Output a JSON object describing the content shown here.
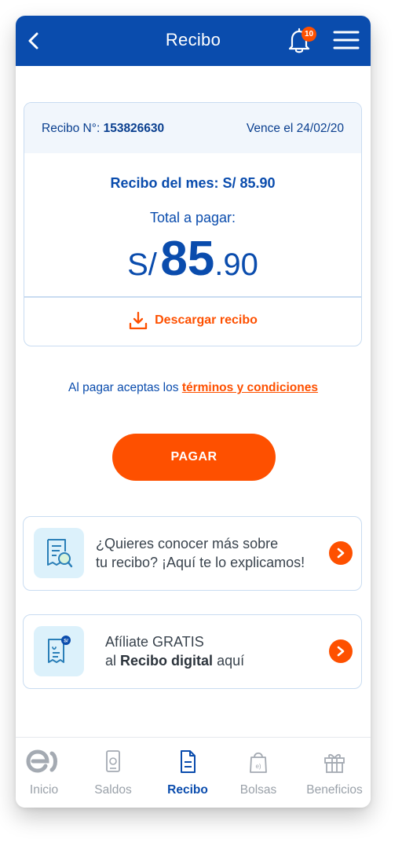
{
  "header": {
    "title": "Recibo",
    "notification_count": "10",
    "back_icon": "chevron-left-icon",
    "bell_icon": "bell-icon",
    "menu_icon": "hamburger-menu-icon"
  },
  "bill": {
    "number_label": "Recibo N°:",
    "number_value": "153826630",
    "due_text": "Vence el 24/02/20",
    "month_text": "Recibo del mes: S/ 85.90",
    "total_label": "Total a pagar:",
    "amount_currency": "S/",
    "amount_integer": "85",
    "amount_decimal": ".90",
    "download_label": "Descargar recibo",
    "download_icon": "download-icon"
  },
  "terms": {
    "prefix": "Al pagar aceptas los",
    "link": "términos y condiciones"
  },
  "pay_button": "PAGAR",
  "promos": [
    {
      "icon": "receipt-search-icon",
      "line1": "¿Quieres conocer más sobre",
      "line2": "tu recibo? ¡Aquí te lo explicamos!"
    },
    {
      "icon": "digital-receipt-icon",
      "line1": "Afíliate GRATIS",
      "line2_prefix": "al",
      "line2_bold": "Recibo digital",
      "line2_suffix": "aquí"
    }
  ],
  "tabs": [
    {
      "label": "Inicio",
      "icon": "entel-logo-icon",
      "active": false
    },
    {
      "label": "Saldos",
      "icon": "phone-icon",
      "active": false
    },
    {
      "label": "Recibo",
      "icon": "document-icon",
      "active": true
    },
    {
      "label": "Bolsas",
      "icon": "shopping-bag-icon",
      "active": false
    },
    {
      "label": "Beneficios",
      "icon": "gift-icon",
      "active": false
    }
  ],
  "colors": {
    "brand_blue": "#0a4cad",
    "accent_orange": "#fe5000",
    "border_blue": "#c9dcf1",
    "inactive_gray": "#9aa1a9"
  }
}
